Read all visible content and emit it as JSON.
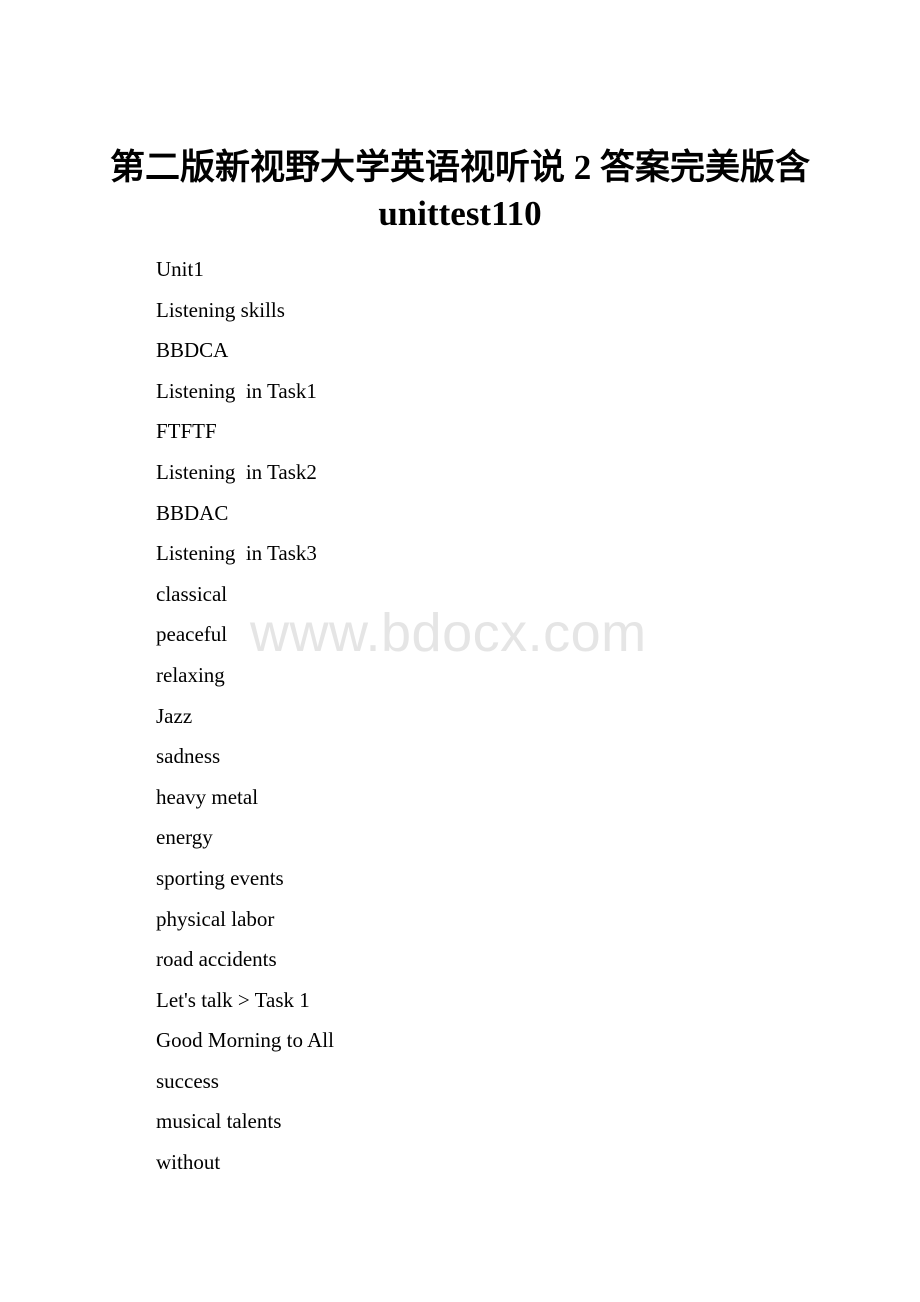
{
  "document": {
    "title_line1": "第二版新视野大学英语视听说 2 答案完美版含",
    "title_line2": "unittest110",
    "watermark": "www.bdocx.com",
    "lines": [
      "Unit1",
      "Listening skills",
      "BBDCA",
      "Listening  in Task1",
      "FTFTF",
      "Listening  in Task2",
      "BBDAC",
      "Listening  in Task3",
      "classical",
      "peaceful",
      "relaxing",
      "Jazz",
      "sadness",
      "heavy metal",
      "energy",
      "sporting events",
      "physical labor",
      "road accidents",
      "Let's talk > Task 1",
      "Good Morning to All",
      "success",
      "musical talents",
      "without"
    ]
  }
}
